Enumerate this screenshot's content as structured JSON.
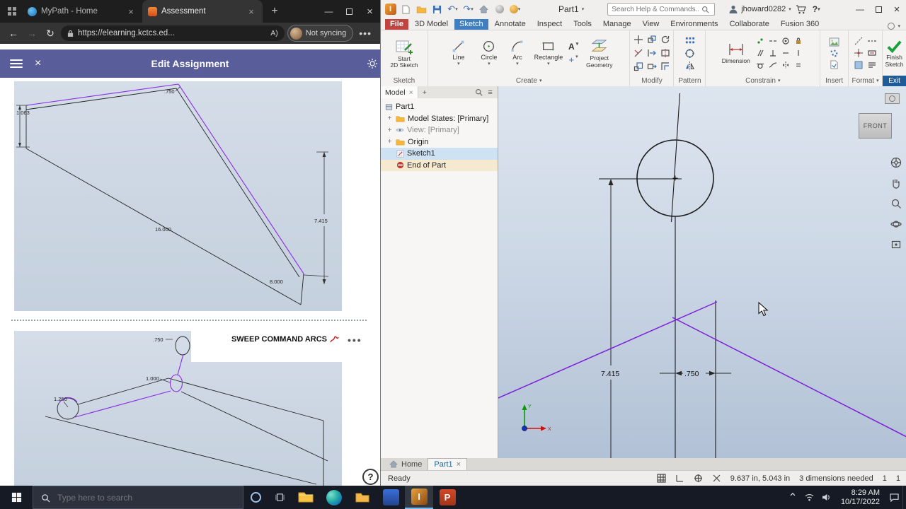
{
  "colors": {
    "header_purple": "#595d99",
    "sketch_purple": "#7b1fd6",
    "ribbon_active_tab_blue": "#3f7ec0",
    "file_tab_red": "#c04540",
    "finish_sketch_green": "#18a03a",
    "exit_label_blue": "#1d5c99"
  },
  "browser": {
    "tabs": [
      {
        "title": "MyPath - Home"
      },
      {
        "title": "Assessment"
      }
    ],
    "nav": {
      "url": "https://elearning.kctcs.ed...",
      "profile": "Not syncing"
    },
    "header": {
      "title": "Edit Assignment"
    },
    "content": {
      "section2_title": "SWEEP COMMAND ARCS",
      "drawing1": {
        "dim_left": "1.063",
        "dim_top": ".750",
        "dim_length": "16.000",
        "dim_bottom": "8.000",
        "dim_height": "7.415"
      },
      "drawing2": {
        "dim_top": ".750",
        "dim_mid": "1.000",
        "dim_circle": "1.250"
      }
    },
    "help": "?"
  },
  "inventor": {
    "titlebar": {
      "doc_title": "Part1",
      "search_placeholder": "Search Help & Commands...",
      "username": "jhoward0282"
    },
    "ribbon_tabs": [
      "File",
      "3D Model",
      "Sketch",
      "Annotate",
      "Inspect",
      "Tools",
      "Manage",
      "View",
      "Environments",
      "Collaborate",
      "Fusion 360"
    ],
    "panels": {
      "sketch": {
        "label": "Sketch",
        "start_line1": "Start",
        "start_line2": "2D Sketch"
      },
      "create": {
        "label": "Create",
        "tools": [
          "Line",
          "Circle",
          "Arc",
          "Rectangle"
        ],
        "text_tool": "A",
        "project_line1": "Project",
        "project_line2": "Geometry"
      },
      "modify": {
        "label": "Modify"
      },
      "pattern": {
        "label": "Pattern"
      },
      "constrain": {
        "label": "Constrain",
        "dimension": "Dimension"
      },
      "insert": {
        "label": "Insert"
      },
      "format": {
        "label": "Format"
      },
      "exit": {
        "label": "Exit",
        "finish_line1": "Finish",
        "finish_line2": "Sketch"
      }
    },
    "model_panel": {
      "tab": "Model",
      "items": [
        {
          "label": "Part1"
        },
        {
          "label": "Model States: [Primary]"
        },
        {
          "label": "View: [Primary]"
        },
        {
          "label": "Origin"
        },
        {
          "label": "Sketch1"
        },
        {
          "label": "End of Part"
        }
      ]
    },
    "graphics": {
      "viewcube": "FRONT",
      "dim_height": "7.415",
      "dim_width": ".750",
      "triad_x": "X",
      "triad_y": "Y"
    },
    "doc_tabs": {
      "home": "Home",
      "active": "Part1"
    },
    "status": {
      "ready": "Ready",
      "coords": "9.637 in, 5.043 in",
      "needed": "3 dimensions needed",
      "n1": "1",
      "n2": "1"
    }
  },
  "taskbar": {
    "search_placeholder": "Type here to search",
    "time": "8:29 AM",
    "date": "10/17/2022"
  }
}
